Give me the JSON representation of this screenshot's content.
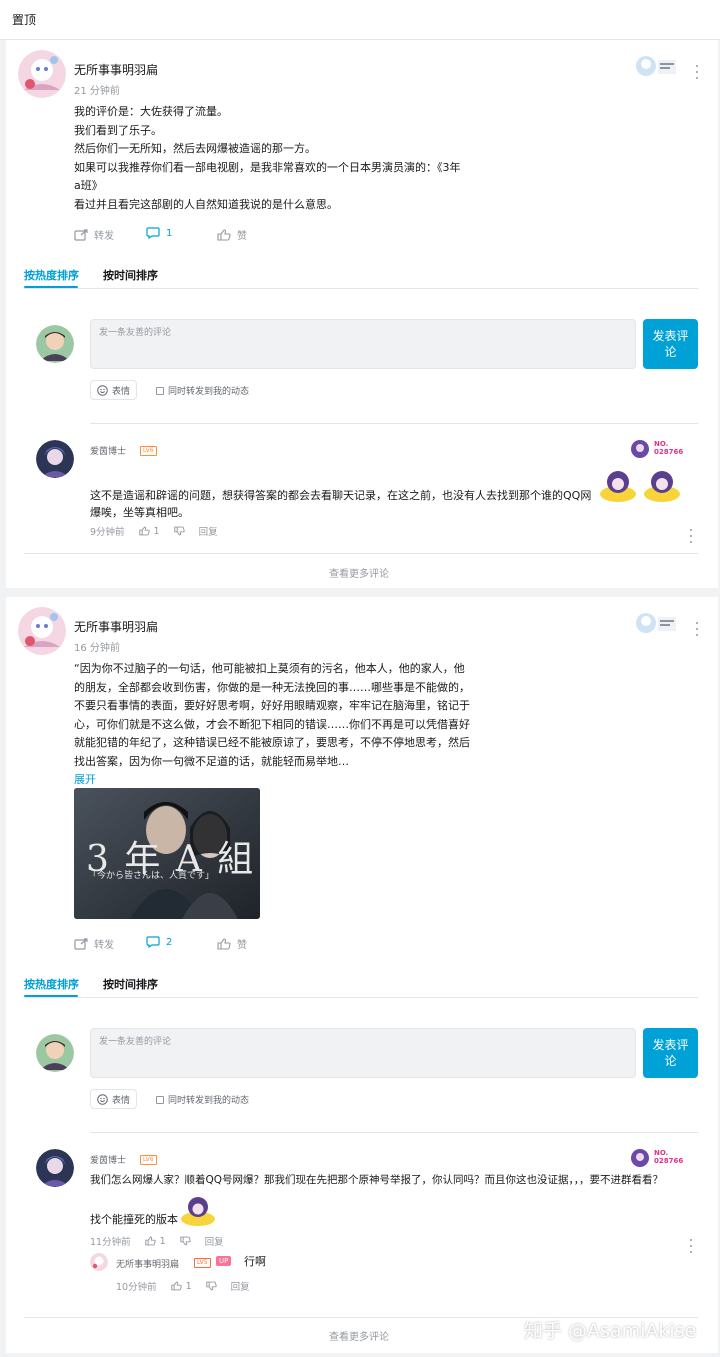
{
  "pinned": {
    "label": "置顶"
  },
  "posts": [
    {
      "author": "无所事事明羽扁",
      "time": "21 分钟前",
      "lines": [
        "我的评价是：大佐获得了流量。",
        "我们看到了乐子。",
        "然后你们一无所知，然后去网爆被造谣的那一方。",
        "如果可以我推荐你们看一部电视剧，是我非常喜欢的一个日本男演员演的：《3年",
        "a班》",
        "看过并且看完这部剧的人自然知道我说的是什么意思。"
      ],
      "actions": {
        "forward": "转发",
        "comment_count": "1",
        "like": "赞"
      },
      "tabs": {
        "hot": "按热度排序",
        "time": "按时间排序"
      },
      "composer": {
        "placeholder": "发一条友善的评论",
        "submit": "发表评论",
        "emoji": "表情",
        "sync": "同时转发到我的动态"
      },
      "comments": [
        {
          "name": "爱茵博士",
          "level": "LV6",
          "badge_no": "NO. 028766",
          "text": "这不是造谣和辟谣的问题，想获得答案的都会去看聊天记录，在这之前，也没有人去找到那个谁的QQ网爆唉，坐等真相吧。",
          "time": "9分钟前",
          "likes": "1",
          "reply": "回复"
        }
      ],
      "more": "查看更多评论"
    },
    {
      "author": "无所事事明羽扁",
      "time": "16 分钟前",
      "lines": [
        "“因为你不过脑子的一句话，他可能被扣上莫须有的污名，他本人，他的家人，他",
        "的朋友，全部都会收到伤害，你做的是一种无法挽回的事……哪些事是不能做的，",
        "不要只看事情的表面，要好好思考啊，好好用眼睛观察，牢牢记在脑海里，铭记于",
        "心，可你们就是不这么做，才会不断犯下相同的错误……你们不再是可以凭借喜好",
        "就能犯错的年纪了，这种错误已经不能被原谅了，要思考，不停不停地思考，然后",
        "找出答案，因为你一句微不足道的话，就能轻而易举地…"
      ],
      "expand": "展开",
      "image": {
        "title": "3 年 A 組",
        "subtitle": "「今から皆さんは、人質です」"
      },
      "actions": {
        "forward": "转发",
        "comment_count": "2",
        "like": "赞"
      },
      "tabs": {
        "hot": "按热度排序",
        "time": "按时间排序"
      },
      "composer": {
        "placeholder": "发一条友善的评论",
        "submit": "发表评论",
        "emoji": "表情",
        "sync": "同时转发到我的动态"
      },
      "comments": [
        {
          "name": "爱茵博士",
          "level": "LV6",
          "badge_no": "NO. 028766",
          "text": "我们怎么网爆人家？顺着QQ号网爆？那我们现在先把那个原神号举报了，你认同吗？而且你这也没证据，，，要不进群看看？",
          "text2": "找个能撞死的版本",
          "time": "11分钟前",
          "likes": "1",
          "reply": "回复",
          "subreply": {
            "name": "无所事事明羽扁",
            "level": "LV5",
            "up": "UP",
            "text": "行啊",
            "time": "10分钟前",
            "likes": "1",
            "reply": "回复"
          }
        }
      ],
      "more": "查看更多评论"
    }
  ],
  "watermark": "知乎 @AsamiAkise",
  "colors": {
    "accent": "#00a1d6",
    "bg": "#f1f2f3",
    "muted": "#9499a0"
  }
}
